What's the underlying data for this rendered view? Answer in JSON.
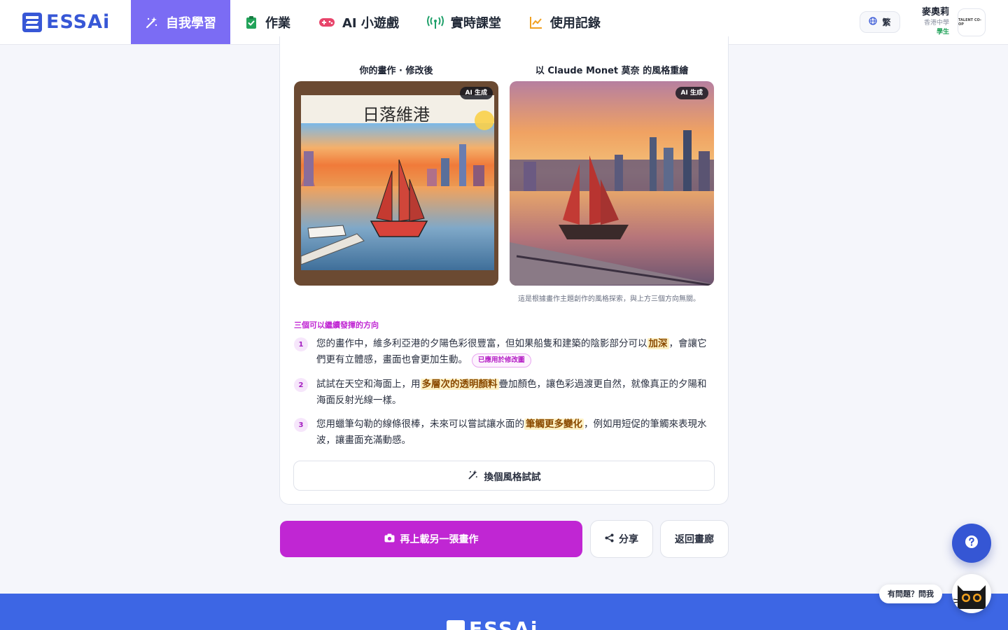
{
  "app": {
    "logo_text": "ESSAi",
    "brand_color": "#3757d6",
    "accent_color": "#7b6cf4",
    "primary_action_color": "#c026d3"
  },
  "nav": {
    "items": [
      {
        "label": "自我學習",
        "icon": "magic-wand-icon",
        "active": true
      },
      {
        "label": "作業",
        "icon": "clipboard-check-icon",
        "active": false
      },
      {
        "label": "AI 小遊戲",
        "icon": "gamepad-icon",
        "active": false
      },
      {
        "label": "實時課堂",
        "icon": "broadcast-icon",
        "active": false
      },
      {
        "label": "使用記錄",
        "icon": "line-chart-icon",
        "active": false
      }
    ]
  },
  "header": {
    "language_label": "繁",
    "user_name": "麥奧莉",
    "school": "香港中學",
    "role": "學生",
    "school_badge_text": "TALENT CO-OP"
  },
  "artwork": {
    "left": {
      "title": "你的畫作 · 修改後",
      "badge": "AI 生成",
      "painted_text": "日落維港"
    },
    "right": {
      "title": "以 Claude Monet 莫奈 的風格重繪",
      "badge": "AI 生成"
    },
    "caption": "這是根據畫作主題創作的風格探索，與上方三個方向無關。"
  },
  "directions": {
    "heading": "三個可以繼續發揮的方向",
    "items": [
      {
        "number": "1",
        "before": "您的畫作中，維多利亞港的夕陽色彩很豐富，但如果船隻和建築的陰影部分可以",
        "highlight": "加深",
        "after": "，會讓它們更有立體感，畫面也會更加生動。",
        "tag": "已應用於修改圖"
      },
      {
        "number": "2",
        "before": "試試在天空和海面上，用",
        "highlight": "多層次的透明顏料",
        "after": "疊加顏色，讓色彩過渡更自然，就像真正的夕陽和海面反射光線一樣。"
      },
      {
        "number": "3",
        "before": "您用蠟筆勾勒的線條很棒，未來可以嘗試讓水面的",
        "highlight": "筆觸更多變化",
        "after": "，例如用短促的筆觸來表現水波，讓畫面充滿動感。"
      }
    ]
  },
  "actions": {
    "retry_label": "換個風格試試",
    "upload_label": "再上載另一張畫作",
    "share_label": "分享",
    "back_label": "返回畫廊"
  },
  "help": {
    "bubble_text": "有問題？問我"
  }
}
